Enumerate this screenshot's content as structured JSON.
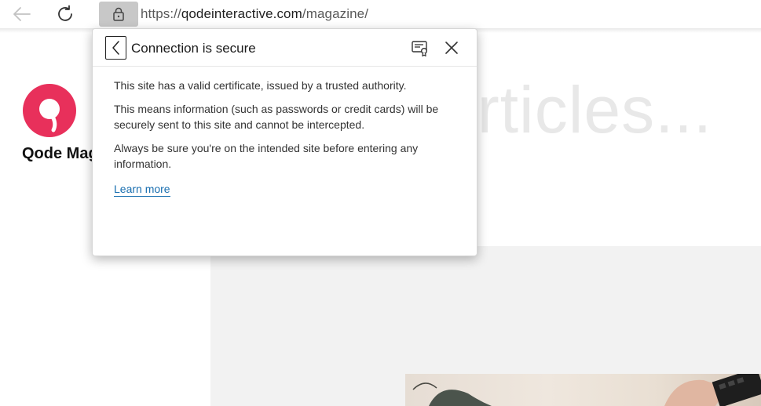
{
  "browser": {
    "url_prefix": "https://",
    "url_domain": "qodeinteractive.com",
    "url_path": "/magazine/",
    "icons": {
      "back": "arrow-left-icon",
      "reload": "reload-icon",
      "lock": "lock-icon"
    }
  },
  "page": {
    "site_name": "Qode Magazine",
    "hero_text": "articles...",
    "logo_color": "#e8305b"
  },
  "popup": {
    "title": "Connection is secure",
    "paragraphs": [
      "This site has a valid certificate, issued by a trusted authority.",
      "This means information (such as passwords or credit cards) will be securely sent to this site and cannot be intercepted.",
      "Always be sure you're on the intended site before entering any information."
    ],
    "learn_more": "Learn more",
    "link_color": "#1a6fb0",
    "icons": {
      "back": "chevron-left-icon",
      "certificate": "certificate-icon",
      "close": "close-icon"
    }
  }
}
